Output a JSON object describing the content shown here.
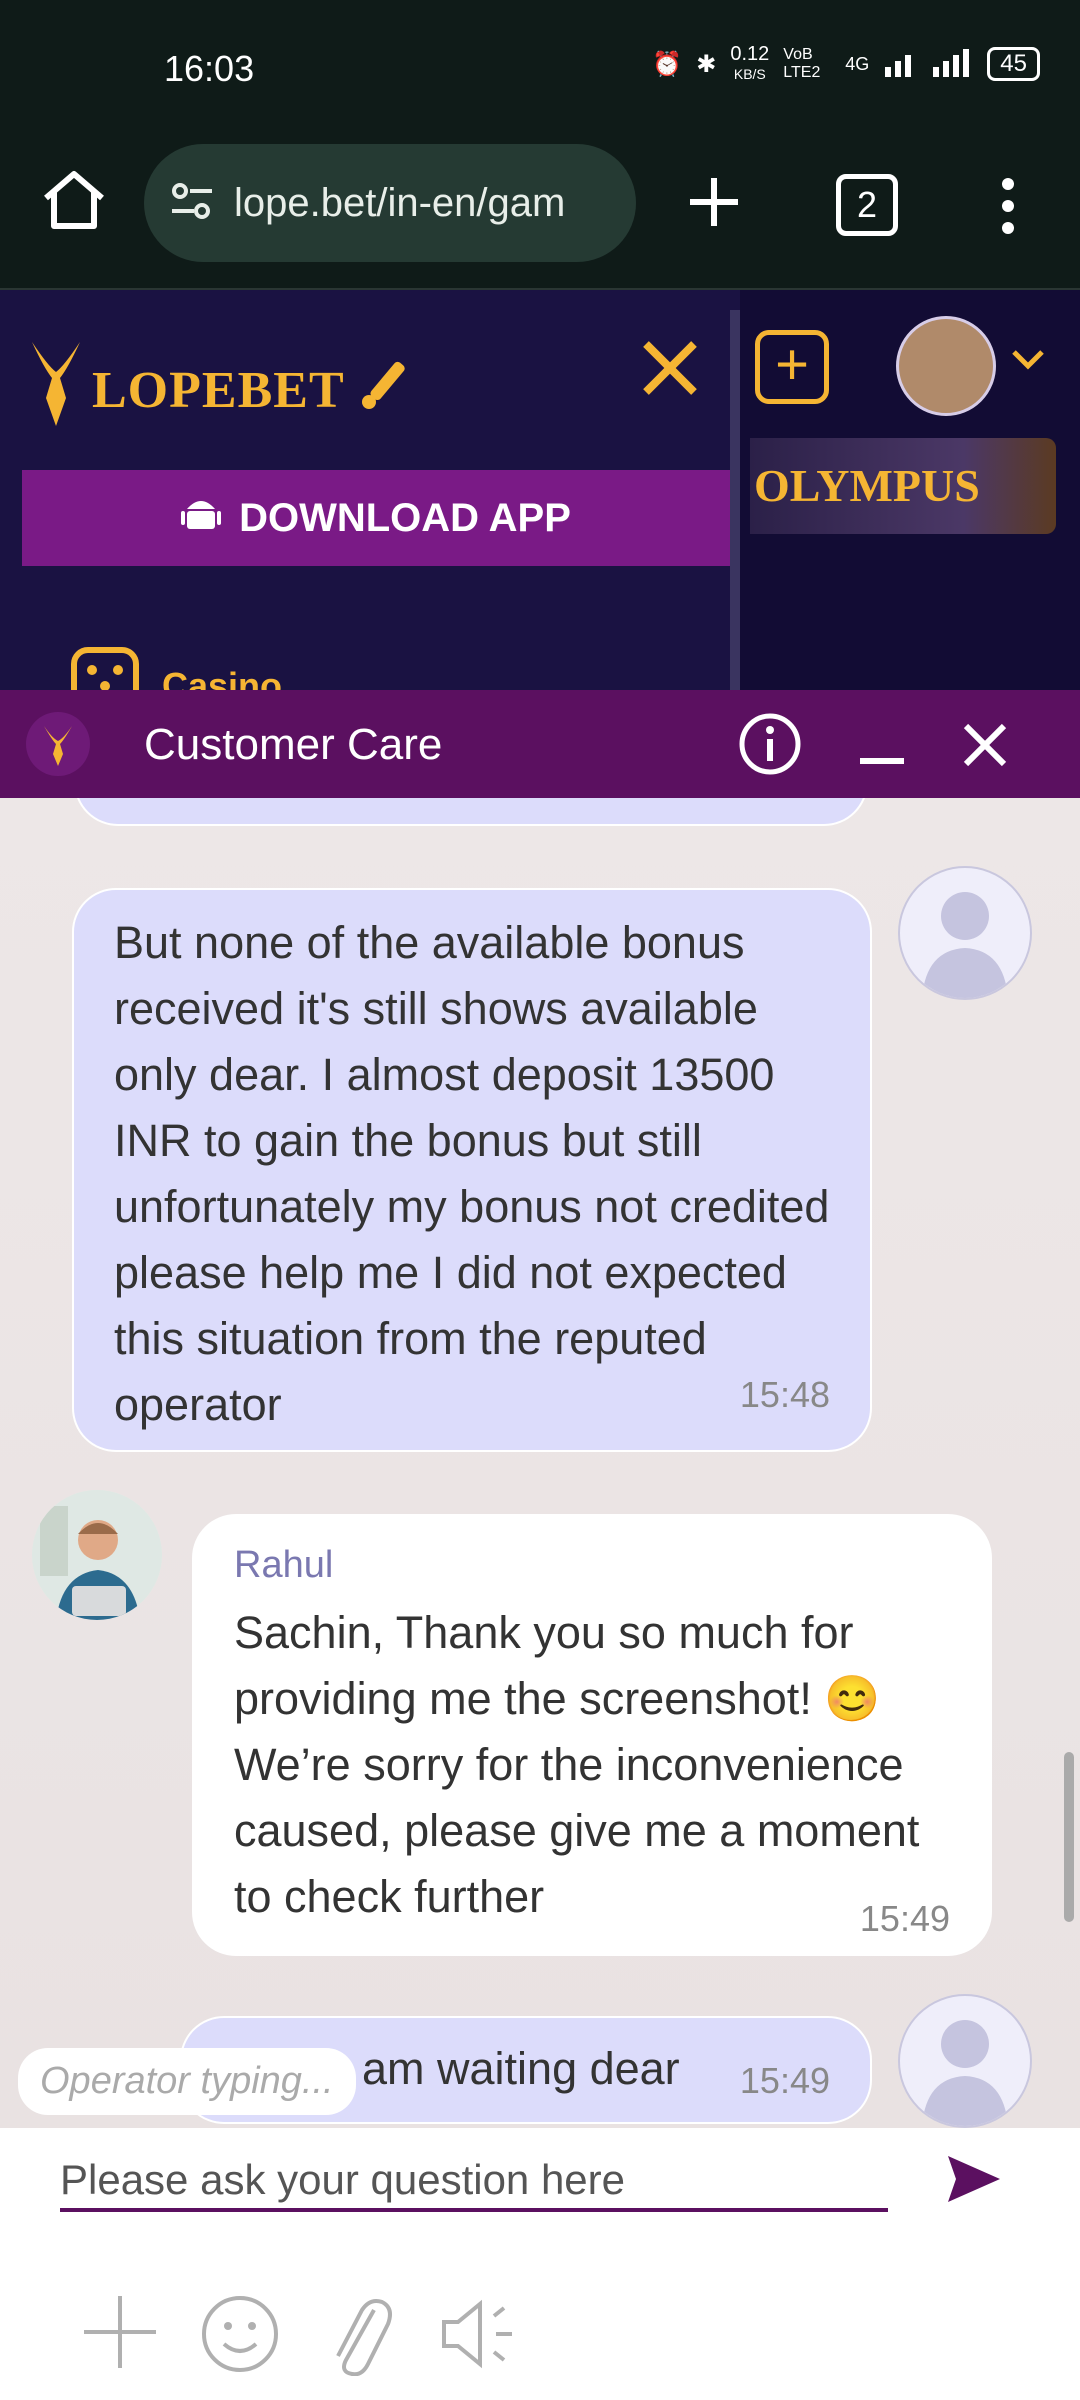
{
  "status_bar": {
    "time": "16:03",
    "net_speed_value": "0.12",
    "net_speed_unit": "KB/S",
    "volte": "VoB LTE2",
    "network": "4G",
    "battery": "45"
  },
  "browser": {
    "url": "lope.bet/in-en/gam",
    "tab_count": "2",
    "home_icon": "home-icon",
    "site_settings_icon": "site-settings-icon",
    "new_tab_icon": "plus-icon",
    "menu_icon": "more-vertical-icon"
  },
  "site": {
    "logo_text": "LOPEBET",
    "download_label": "DOWNLOAD APP",
    "menu_item_casino": "Casino",
    "banner_text": "OLYMPUS",
    "accent_color": "#f5b533",
    "menu_bg": "#1a1242"
  },
  "chat": {
    "header_title": "Customer Care",
    "header_color": "#5b1060",
    "messages": [
      {
        "from": "user",
        "text": "But none of the available bonus received it's still shows available only dear. I almost deposit 13500 INR to gain the bonus but still unfortunately my bonus not credited please help me I did not expected this situation from the reputed operator",
        "time": "15:48"
      },
      {
        "from": "operator",
        "name": "Rahul",
        "text": "Sachin, Thank you so much for providing me the screenshot! 😊 We’re sorry for the inconvenience caused, please give me a moment to check further",
        "time": "15:49"
      },
      {
        "from": "user",
        "text": "am waiting dear",
        "time": "15:49"
      }
    ],
    "typing_indicator": "Operator typing...",
    "input_placeholder": "Please ask your question here"
  }
}
